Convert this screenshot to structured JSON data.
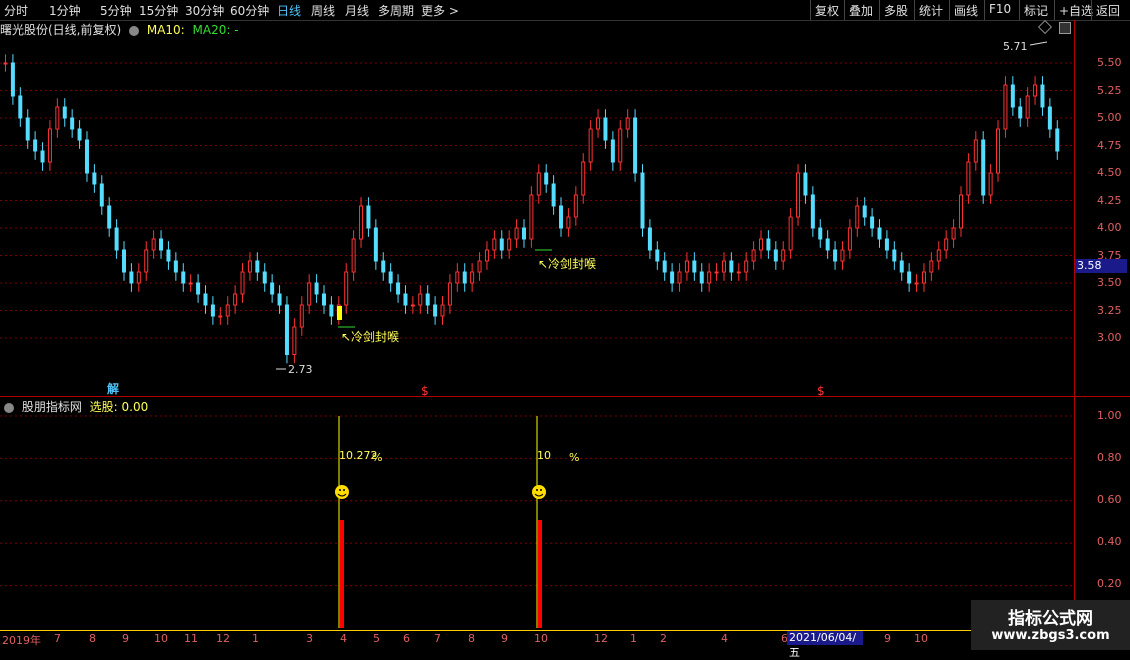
{
  "toolbar": {
    "periods": [
      "分时",
      "1分钟",
      "5分钟",
      "15分钟",
      "30分钟",
      "60分钟",
      "日线",
      "周线",
      "月线",
      "多周期",
      "更多 >"
    ],
    "active": "日线",
    "actions": [
      "复权",
      "叠加",
      "多股",
      "统计",
      "画线",
      "F10",
      "标记",
      "+自选",
      "返回"
    ]
  },
  "main": {
    "title": "曙光股份(日线,前复权)",
    "ma10_label": "MA10:",
    "ma20_label": "MA20: -",
    "price_labels": [
      "5.50",
      "5.25",
      "5.00",
      "4.75",
      "4.50",
      "4.25",
      "4.00",
      "3.75",
      "3.50",
      "3.25",
      "3.00"
    ],
    "current_price": "3.58",
    "high_label": "5.71",
    "low_label": "2.73",
    "annotations": [
      "↖冷剑封喉",
      "↖冷剑封喉"
    ],
    "markers": [
      "解",
      "$",
      "$"
    ]
  },
  "sub": {
    "title": "股朋指标网",
    "value_label": "选股: 0.00",
    "axis_labels": [
      "1.00",
      "0.80",
      "0.60",
      "0.40",
      "0.20"
    ],
    "signal1_text": "10.272",
    "signal1_pct": "%",
    "signal2_text": "10",
    "signal2_pct": "%"
  },
  "dates": {
    "labels": [
      "2019年",
      "7",
      "8",
      "9",
      "10",
      "11",
      "12",
      "1",
      "3",
      "4",
      "5",
      "6",
      "7",
      "8",
      "9",
      "10",
      "12",
      "1",
      "2",
      "4",
      "6",
      "9",
      "10"
    ],
    "cursor_date": "2021/06/04/五"
  },
  "watermark": {
    "line1": "指标公式网",
    "line2": "www.zbgs3.com"
  },
  "colors": {
    "up": "#ff3333",
    "down": "#55ddff",
    "grid": "#b00000",
    "accent": "#ffff00"
  },
  "chart_data": {
    "type": "candlestick",
    "title": "曙光股份(日线,前复权)",
    "ylim": [
      2.6,
      5.8
    ],
    "y_ticks": [
      3.0,
      3.25,
      3.5,
      3.75,
      4.0,
      4.25,
      4.5,
      4.75,
      5.0,
      5.25,
      5.5
    ],
    "close_series": [
      5.5,
      5.2,
      5.0,
      4.8,
      4.7,
      4.6,
      4.9,
      5.1,
      5.0,
      4.9,
      4.8,
      4.5,
      4.4,
      4.2,
      4.0,
      3.8,
      3.6,
      3.5,
      3.6,
      3.8,
      3.9,
      3.8,
      3.7,
      3.6,
      3.5,
      3.5,
      3.4,
      3.3,
      3.2,
      3.2,
      3.3,
      3.4,
      3.6,
      3.7,
      3.6,
      3.5,
      3.4,
      3.3,
      2.85,
      3.1,
      3.3,
      3.5,
      3.4,
      3.3,
      3.2,
      3.3,
      3.6,
      3.9,
      4.2,
      4.0,
      3.7,
      3.6,
      3.5,
      3.4,
      3.3,
      3.3,
      3.4,
      3.3,
      3.2,
      3.3,
      3.5,
      3.6,
      3.5,
      3.6,
      3.7,
      3.8,
      3.9,
      3.8,
      3.9,
      4.0,
      3.9,
      4.3,
      4.5,
      4.4,
      4.2,
      4.0,
      4.1,
      4.3,
      4.6,
      4.9,
      5.0,
      4.8,
      4.6,
      4.9,
      5.0,
      4.5,
      4.0,
      3.8,
      3.7,
      3.6,
      3.5,
      3.6,
      3.7,
      3.6,
      3.5,
      3.6,
      3.6,
      3.7,
      3.6,
      3.6,
      3.7,
      3.8,
      3.9,
      3.8,
      3.7,
      3.8,
      4.1,
      4.5,
      4.3,
      4.0,
      3.9,
      3.8,
      3.7,
      3.8,
      4.0,
      4.2,
      4.1,
      4.0,
      3.9,
      3.8,
      3.7,
      3.6,
      3.5,
      3.5,
      3.6,
      3.7,
      3.8,
      3.9,
      4.0,
      4.3,
      4.6,
      4.8,
      4.3,
      4.5,
      4.9,
      5.3,
      5.1,
      5.0,
      5.2,
      5.3,
      5.1,
      4.9,
      4.7
    ],
    "high": 5.71,
    "low": 2.73,
    "last": 3.58
  },
  "sub_chart_data": {
    "type": "bar",
    "ylim": [
      0,
      1.0
    ],
    "signals": [
      {
        "position": 0.317,
        "value": 1.0
      },
      {
        "position": 0.5,
        "value": 1.0
      }
    ]
  }
}
